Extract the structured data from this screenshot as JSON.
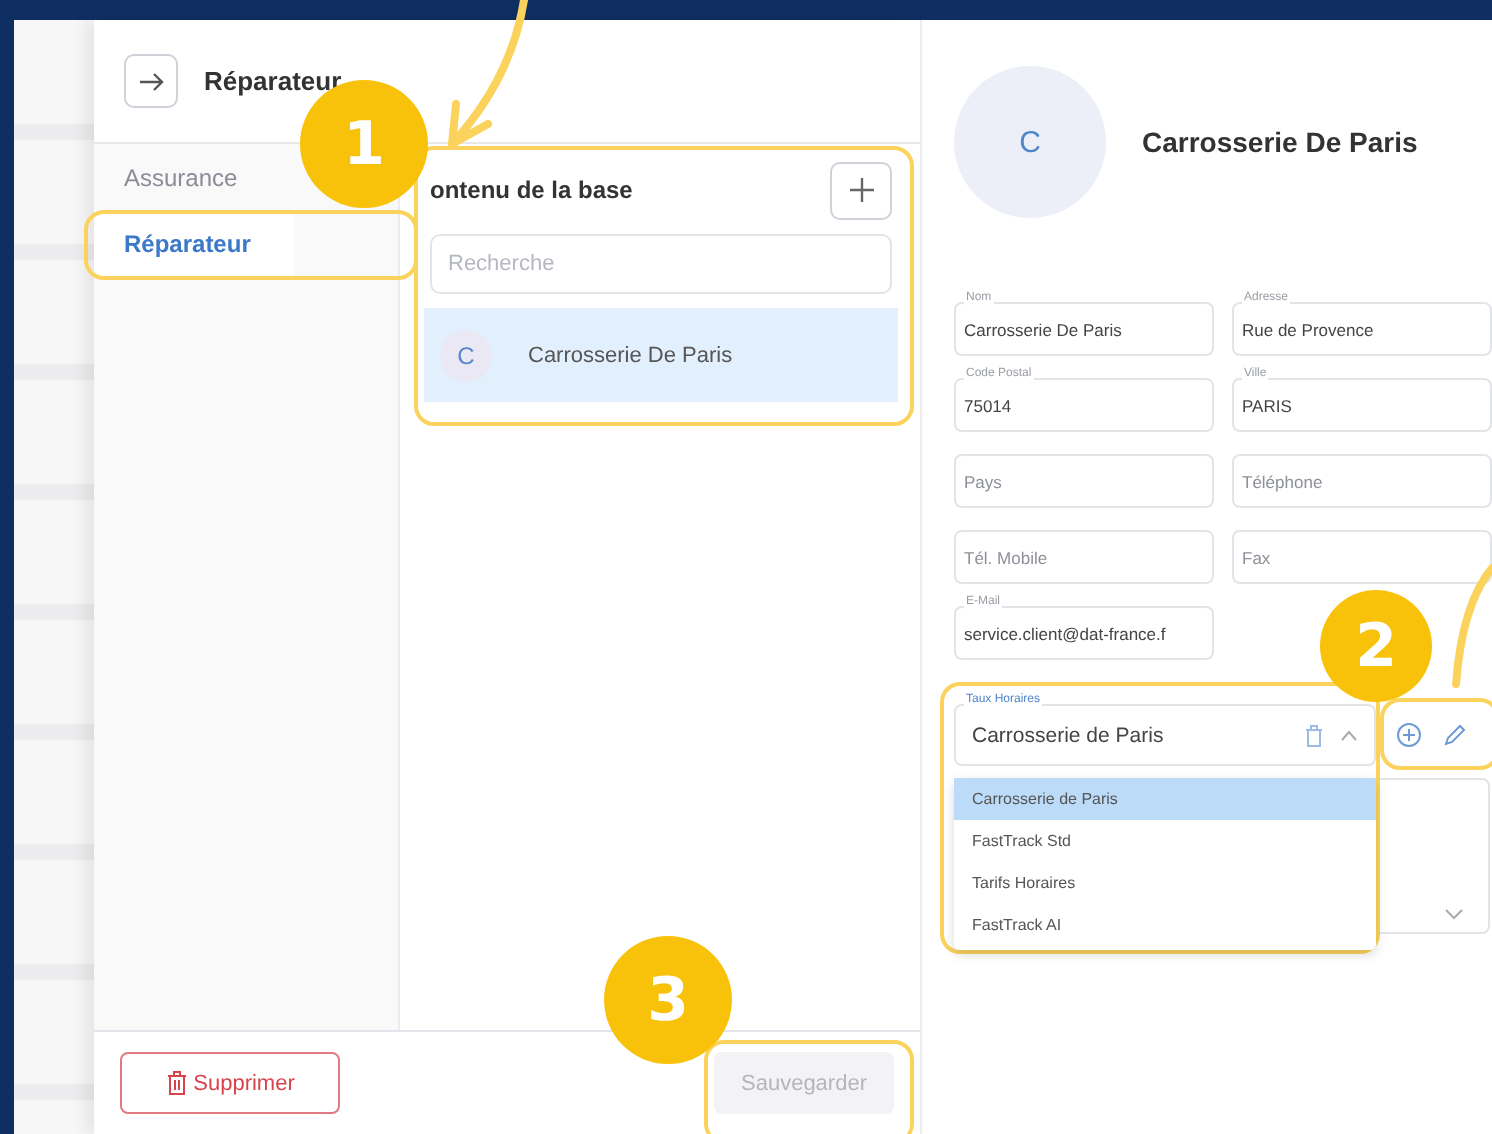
{
  "header": {
    "title": "Réparateur"
  },
  "sidebar": {
    "items": [
      {
        "label": "Assurance",
        "selected": false
      },
      {
        "label": "Réparateur",
        "selected": true
      }
    ]
  },
  "list": {
    "title": "ontenu de la base",
    "search": {
      "placeholder": "Recherche"
    },
    "items": [
      {
        "initial": "C",
        "name": "Carrosserie De Paris",
        "selected": true
      }
    ]
  },
  "detail": {
    "initial": "C",
    "title": "Carrosserie De Paris",
    "fields": [
      {
        "label": "Nom",
        "value": "Carrosserie De Paris"
      },
      {
        "label": "Adresse",
        "value": "Rue de Provence"
      },
      {
        "label": "Code Postal",
        "value": "75014"
      },
      {
        "label": "Ville",
        "value": "PARIS"
      },
      {
        "placeholder": "Pays"
      },
      {
        "placeholder": "Téléphone"
      },
      {
        "placeholder": "Tél. Mobile"
      },
      {
        "placeholder": "Fax"
      },
      {
        "label": "E-Mail",
        "value": "service.client@dat-france.f"
      }
    ],
    "rate": {
      "label": "Taux Horaires",
      "value": "Carrosserie de Paris",
      "expanded": true,
      "options": [
        {
          "label": "Carrosserie de Paris",
          "selected": true
        },
        {
          "label": "FastTrack Std",
          "selected": false
        },
        {
          "label": "Tarifs Horaires",
          "selected": false
        },
        {
          "label": "FastTrack AI",
          "selected": false
        }
      ]
    }
  },
  "footer": {
    "delete": "Supprimer",
    "save": {
      "label": "Sauvegarder",
      "disabled": true
    }
  },
  "annotations": [
    "1",
    "2",
    "3"
  ]
}
